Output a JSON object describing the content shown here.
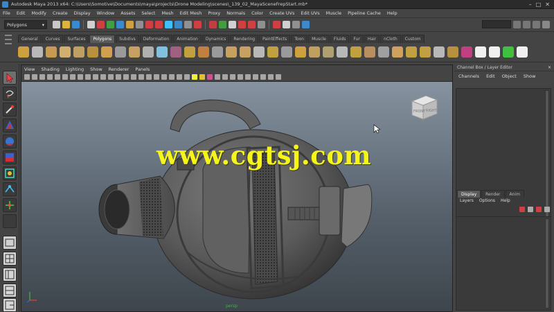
{
  "titlebar": {
    "title": "Autodesk Maya 2013 x64: C:\\Users\\Somotive\\Documents\\maya\\projects\\Drone Modeling\\scenes\\_139_02_MayaSceneFrepStart.mb*",
    "buttons": [
      "–",
      "□",
      "✕"
    ]
  },
  "menubar": {
    "items": [
      "File",
      "Edit",
      "Modify",
      "Create",
      "Display",
      "Window",
      "Assets",
      "Select",
      "Mesh",
      "Edit Mesh",
      "Proxy",
      "Normals",
      "Color",
      "Create UVs",
      "Edit UVs",
      "Muscle",
      "Pipeline Cache",
      "Help"
    ]
  },
  "statusline": {
    "mode": "Polygons"
  },
  "shelf": {
    "tabs": [
      "General",
      "Curves",
      "Surfaces",
      "Polygons",
      "Subdivs",
      "Deformation",
      "Animation",
      "Dynamics",
      "Rendering",
      "PaintEffects",
      "Toon",
      "Muscle",
      "Fluids",
      "Fur",
      "Hair",
      "nCloth",
      "Custom"
    ],
    "active_tab": "Polygons"
  },
  "viewport": {
    "menu": [
      "View",
      "Shading",
      "Lighting",
      "Show",
      "Renderer",
      "Panels"
    ],
    "viewcube_faces": [
      "FRONT",
      "RIGHT"
    ],
    "camera": "persp",
    "watermark": "www.cgtsj.com"
  },
  "channelbox": {
    "header": "Channel Box / Layer Editor",
    "menu": [
      "Channels",
      "Edit",
      "Object",
      "Show"
    ]
  },
  "layereditor": {
    "tabs": [
      "Display",
      "Render",
      "Anim"
    ],
    "active_tab": "Display",
    "menu": [
      "Layers",
      "Options",
      "Help"
    ]
  },
  "colors": {
    "accent": "#5a5a5a",
    "watermark": "#f6f51a",
    "viewport_top": "#8c99a6",
    "viewport_bottom": "#3e454c"
  }
}
